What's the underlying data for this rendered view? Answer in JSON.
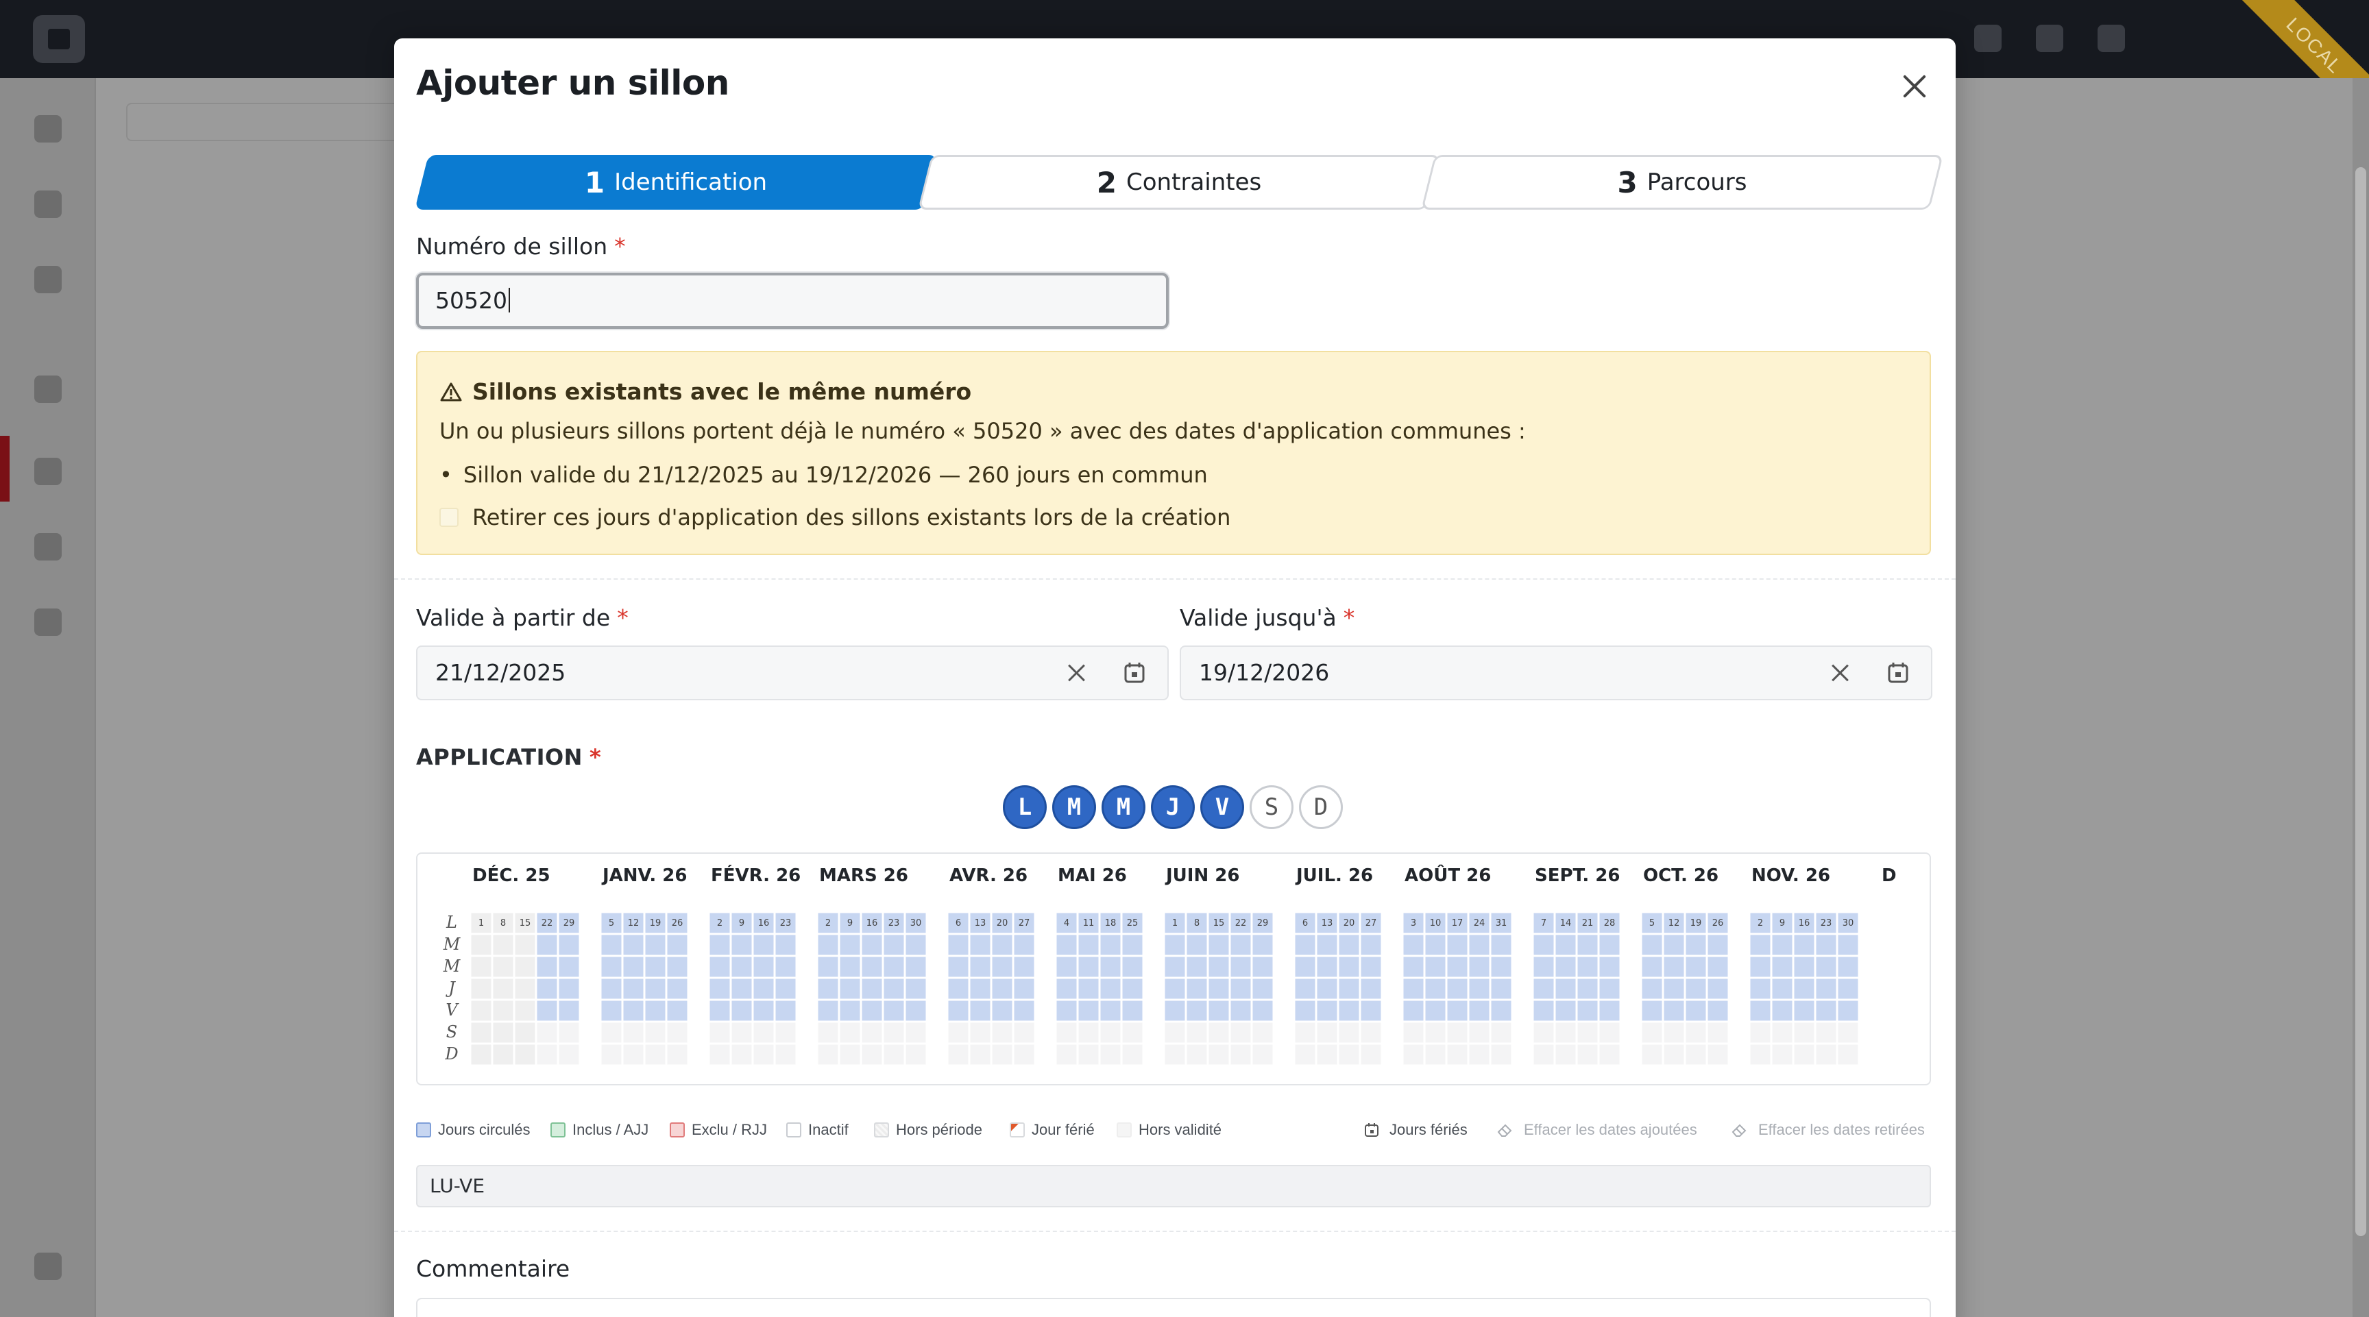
{
  "modal": {
    "title": "Ajouter un sillon",
    "steps": [
      {
        "num": "1",
        "label": "Identification",
        "active": true
      },
      {
        "num": "2",
        "label": "Contraintes",
        "active": false
      },
      {
        "num": "3",
        "label": "Parcours",
        "active": false
      }
    ],
    "numero": {
      "label": "Numéro de sillon",
      "required_mark": "*",
      "value": "50520"
    },
    "warning": {
      "title": "Sillons existants avec le même numéro",
      "text": "Un ou plusieurs sillons portent déjà le numéro « 50520 » avec des dates d'application communes :",
      "bullet": "Sillon valide du 21/12/2025 au 19/12/2026 — 260 jours en commun",
      "checkbox_label": "Retirer ces jours d'application des sillons existants lors de la création",
      "checked": false
    },
    "valid_from": {
      "label": "Valide à partir de",
      "required_mark": "*",
      "value": "21/12/2025"
    },
    "valid_to": {
      "label": "Valide jusqu'à",
      "required_mark": "*",
      "value": "19/12/2026"
    },
    "application": {
      "label": "APPLICATION",
      "required_mark": "*",
      "days": [
        {
          "letter": "L",
          "on": true
        },
        {
          "letter": "M",
          "on": true
        },
        {
          "letter": "M",
          "on": true
        },
        {
          "letter": "J",
          "on": true
        },
        {
          "letter": "V",
          "on": true
        },
        {
          "letter": "S",
          "on": false
        },
        {
          "letter": "D",
          "on": false
        }
      ]
    },
    "calendar": {
      "row_labels": [
        "L",
        "M",
        "M",
        "J",
        "V",
        "S",
        "D"
      ],
      "months": [
        {
          "label": "DÉC. 25",
          "dates": [
            "1",
            "8",
            "15",
            "22",
            "29"
          ]
        },
        {
          "label": "JANV. 26",
          "dates": [
            "5",
            "12",
            "19",
            "26"
          ]
        },
        {
          "label": "FÉVR. 26",
          "dates": [
            "2",
            "9",
            "16",
            "23"
          ]
        },
        {
          "label": "MARS 26",
          "dates": [
            "2",
            "9",
            "16",
            "23",
            "30"
          ]
        },
        {
          "label": "AVR. 26",
          "dates": [
            "6",
            "13",
            "20",
            "27"
          ]
        },
        {
          "label": "MAI 26",
          "dates": [
            "4",
            "11",
            "18",
            "25"
          ]
        },
        {
          "label": "JUIN 26",
          "dates": [
            "1",
            "8",
            "15",
            "22",
            "29"
          ]
        },
        {
          "label": "JUIL. 26",
          "dates": [
            "6",
            "13",
            "20",
            "27"
          ]
        },
        {
          "label": "AOÛT 26",
          "dates": [
            "3",
            "10",
            "17",
            "24",
            "31"
          ]
        },
        {
          "label": "SEPT. 26",
          "dates": [
            "7",
            "14",
            "21",
            "28"
          ]
        },
        {
          "label": "OCT. 26",
          "dates": [
            "5",
            "12",
            "19",
            "26"
          ]
        },
        {
          "label": "NOV. 26",
          "dates": [
            "2",
            "9",
            "16",
            "23",
            "30"
          ]
        },
        {
          "label": "D",
          "dates": []
        }
      ]
    },
    "legend": [
      {
        "label": "Jours circulés",
        "color": "#c7d6f1",
        "border": "#7f9fd8"
      },
      {
        "label": "Inclus / AJJ",
        "color": "#d5eedd",
        "border": "#7fc296"
      },
      {
        "label": "Exclu / RJJ",
        "color": "#f7d5d5",
        "border": "#e07b7b"
      },
      {
        "label": "Inactif",
        "color": "#ffffff",
        "border": "#c9ccd1"
      },
      {
        "label": "Hors période",
        "color": "#f3f3f3",
        "border": "#d8dadd"
      },
      {
        "label": "Jour férié",
        "color": "#ffffff",
        "border": "#d8dadd"
      },
      {
        "label": "Hors validité",
        "color": "#f5f5f5",
        "border": "#eeeeee"
      }
    ],
    "legend_actions": [
      {
        "label": "Jours fériés",
        "icon": "calendar-icon"
      },
      {
        "label": "Effacer les dates ajoutées",
        "icon": "eraser-icon"
      },
      {
        "label": "Effacer les dates retirées",
        "icon": "eraser-icon"
      }
    ],
    "summary": "LU-VE",
    "comment": {
      "label": "Commentaire",
      "value": ""
    }
  },
  "colors": {
    "accent": "#0b7bd1",
    "day_on": "#2f67c4",
    "circulated": "#c7d6f1",
    "holiday_flag": "#e0592b",
    "warning_bg": "#fdf3d2"
  }
}
